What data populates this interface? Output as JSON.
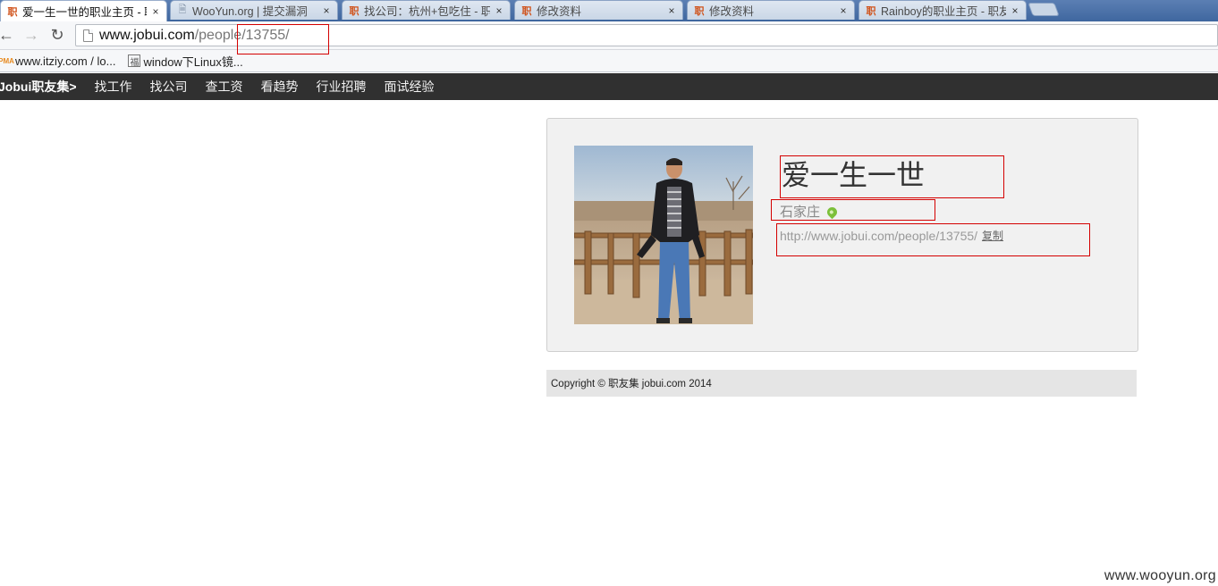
{
  "browser": {
    "tabs": [
      {
        "title": "爱一生一世的职业主页 - 职",
        "favicon": "职",
        "active": true
      },
      {
        "title": "WooYun.org | 提交漏洞",
        "favicon": "doc-icon",
        "active": false
      },
      {
        "title": "找公司：杭州+包吃住 - 职",
        "favicon": "职",
        "active": false
      },
      {
        "title": "修改资料",
        "favicon": "职",
        "active": false
      },
      {
        "title": "修改资料",
        "favicon": "职",
        "active": false
      },
      {
        "title": "Rainboy的职业主页 - 职友",
        "favicon": "职",
        "active": false
      }
    ],
    "close_glyph": "×",
    "url": {
      "host": "www.jobui.com",
      "path": "/people/13755/"
    },
    "bookmarks": [
      {
        "label": "www.itziy.com / lo...",
        "icon": "PMA"
      },
      {
        "label": "window下Linux镜...",
        "icon": "福"
      }
    ]
  },
  "site": {
    "logo": "Jobui职友集>",
    "nav": [
      "找工作",
      "找公司",
      "查工资",
      "看趋势",
      "行业招聘",
      "面试经验"
    ]
  },
  "profile": {
    "name": "爱一生一世",
    "city": "石家庄",
    "link": "http://www.jobui.com/people/13755/",
    "copy_label": "复制"
  },
  "footer": {
    "text": "Copyright © 职友集 jobui.com 2014"
  },
  "watermark": "www.wooyun.org",
  "colors": {
    "nav_bg": "#303030",
    "annotation_red": "#d40000",
    "pin_green": "#7cc03a"
  }
}
